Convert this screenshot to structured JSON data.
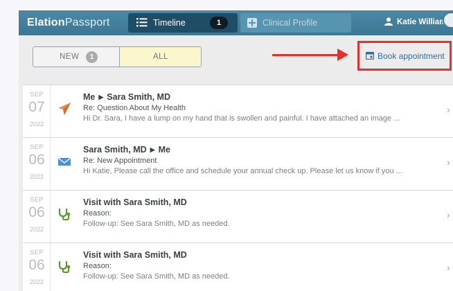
{
  "app": {
    "logo_bold": "Elation",
    "logo_light": "Passport",
    "user_name": "Katie William"
  },
  "tabs": [
    {
      "label": "Timeline",
      "count": "1",
      "icon": "list-icon",
      "active": true
    },
    {
      "label": "Clinical Profile",
      "icon": "plus-box-icon",
      "active": false
    }
  ],
  "filter": {
    "new_label": "NEW",
    "new_count": "1",
    "all_label": "ALL",
    "selected": "ALL"
  },
  "book_appointment": {
    "label": "Book appointment",
    "icon": "calendar-icon"
  },
  "colors": {
    "header": "#3c7793",
    "annotation_red": "#e3322b",
    "link": "#2f6f9a",
    "selected_filter": "#fbf6cc"
  },
  "timeline": [
    {
      "month": "SEP",
      "day": "07",
      "year": "2022",
      "icon": "paper-plane-icon",
      "from": "Me",
      "to": "Sara Smith, MD",
      "subject": "Re: Question About My Health",
      "preview": "Hi Dr. Sara, I have a lump on my hand that is swollen and painful. I have attached an image ..."
    },
    {
      "month": "SEP",
      "day": "06",
      "year": "2022",
      "icon": "envelope-icon",
      "from": "Sara Smith, MD",
      "to": "Me",
      "subject": "Re: New Appointment",
      "preview": "Hi Katie, Please call the office and schedule your annual check up. Please let us know if you ..."
    },
    {
      "month": "SEP",
      "day": "06",
      "year": "2022",
      "icon": "stethoscope-icon",
      "visit_title": "Visit with Sara Smith, MD",
      "subject": "Reason:",
      "preview": "Follow-up: See Sara Smith, MD as needed."
    },
    {
      "month": "SEP",
      "day": "06",
      "year": "2022",
      "icon": "stethoscope-icon",
      "visit_title": "Visit with Sara Smith, MD",
      "subject": "Reason:",
      "preview": "Follow-up: See Sara Smith, MD as needed."
    }
  ]
}
